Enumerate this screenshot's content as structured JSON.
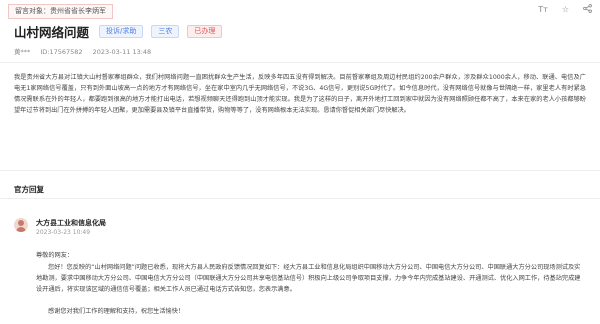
{
  "header": {
    "recipient_label": "留言对象：",
    "recipient_value": "贵州省省长李炳军",
    "font_size_icon": "Tт",
    "star_icon": "star-outline-icon",
    "share_icon": "share-icon"
  },
  "message": {
    "title": "山村网络问题",
    "tag_category": "投诉/求助",
    "tag_type": "三农",
    "tag_status": "已办理",
    "author": "黄***",
    "id": "ID:17567582",
    "datetime": "2023-03-11 13:48",
    "body": "我是贵州省大方县对江镇大山村督家寨组群众，我们村网络问题一直困扰群众生产生活，反映多年四五没有得到解决。目前督家寨组及周边村民组约200余户群众，涉及群众1000余人，移动、联通、电信及广电无1家网络信号覆盖，只有到外面山坡高一点的地方才有网络信号，坐在家中室内几乎无网络信号，不说3G、4G信号，更别说5G时代了。如今信息时代，没有网络信号就像与世隔绝一样，家里老人有时紧急情况需联系在外的年轻人，都要跑到很高的地方才能打出电话，若想视频聊天还得跑到山顶才能实现。我是为了这样的日子，离开外地打工回到家中就因为没有网络照顾任都不高了，本来在家的老人小孩都够盼望年过节将到出门在外拼搏的年轻人团聚，更加需要县及镇平台直播带货，购物等等了，没有网络根本无法实现。恳请你督促相关部门尽快解决。"
  },
  "reply": {
    "section_title": "官方回复",
    "org": "大方县工业和信息化局",
    "datetime": "2023-03-23 10:49",
    "greeting": "尊敬的网友：",
    "text": "您好！您反映的“山村网络问题”问题已收悉，现将大方县人民政府反馈情况回复如下：经大方县工业和信息化局组织中国移动大方分公司、中国电信大方分公司、中国联通大方分公司现场测试及实地勘测，要求中国移动大方分公司、中国电信大方分公司（中国联通大方分公司共享电信基站信号）积极向上级公司争取项目支撑，力争今年内完成基站建设、开通测试、优化入网工作，待基站完成建设开通后，将实现该区域的通信信号覆盖；相关工作人员已通过电话方式告知您，您表示满意。",
    "thanks": "感谢您对我们工作的理解和支持，祝您生活愉快！"
  }
}
